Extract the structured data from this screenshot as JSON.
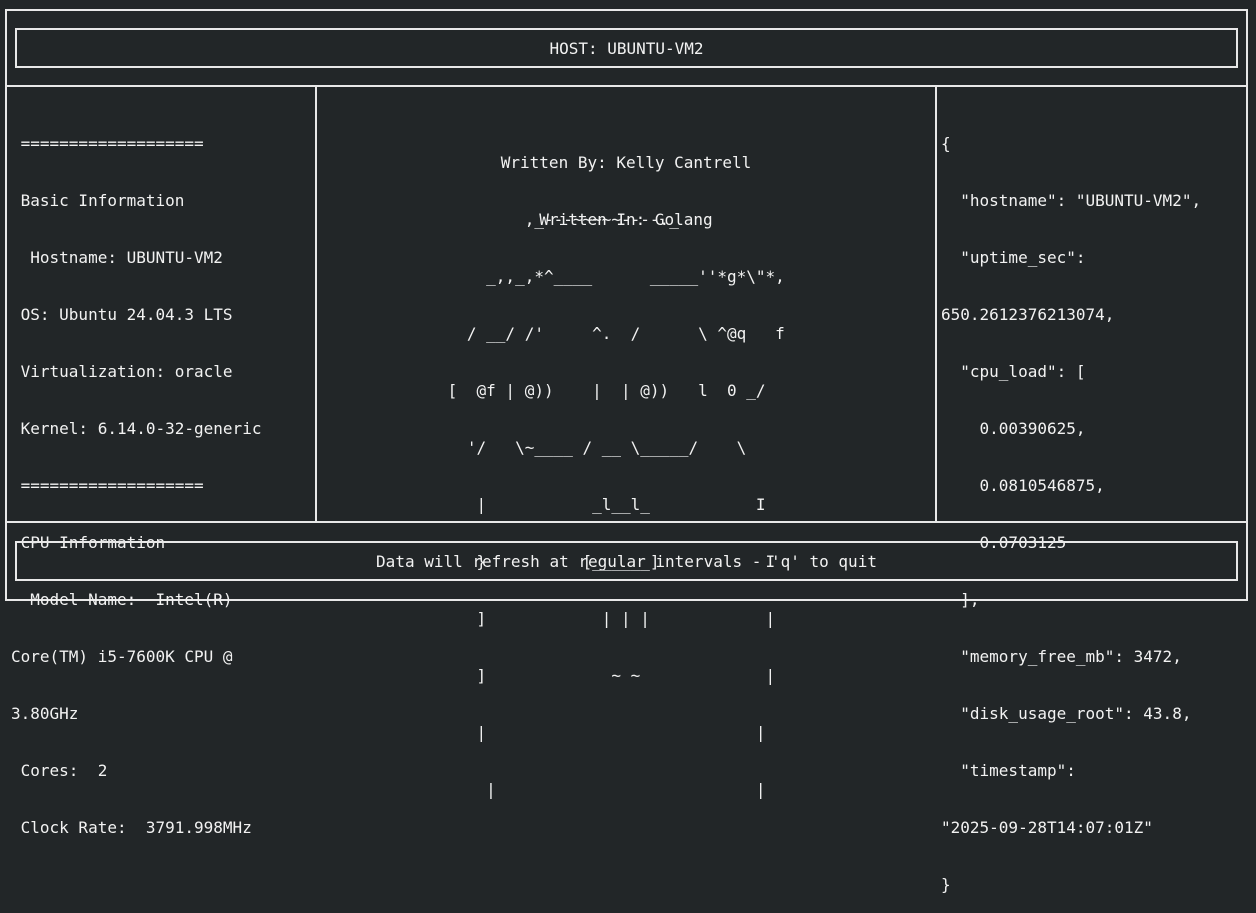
{
  "header": {
    "title": "HOST: UBUNTU-VM2"
  },
  "footer": {
    "message": "Data will refresh at regular intervals - 'q' to quit"
  },
  "left_panel": {
    "lines": [
      " ===================",
      " Basic Information",
      "  Hostname: UBUNTU-VM2",
      " OS: Ubuntu 24.04.3 LTS",
      " Virtualization: oracle",
      " Kernel: 6.14.0-32-generic",
      " ===================",
      " CPU Information",
      "  Model Name:  Intel(R)",
      "Core(TM) i5-7600K CPU @",
      "3.80GHz",
      " Cores:  2",
      " Clock Rate:  3791.998MHz"
    ]
  },
  "center_panel": {
    "author": "Written By: Kelly Cantrell",
    "language": "Written In: Golang",
    "ascii_art": [
      "         ,_---~~~~~----._",
      "     _,,_,*^____      _____''*g*\\\"*,",
      "   / __/ /'     ^.  /      \\ ^@q   f",
      " [  @f | @))    |  | @))   l  0 _/",
      "   '/   \\~____ / __ \\_____/    \\",
      "    |           _l__l_           I",
      "    }          [______]           I",
      "    ]            | | |            |",
      "    ]             ~ ~             |",
      "    |                            |",
      "     |                           |"
    ]
  },
  "right_panel": {
    "lines": [
      "{",
      "  \"hostname\": \"UBUNTU-VM2\",",
      "  \"uptime_sec\":",
      "650.2612376213074,",
      "  \"cpu_load\": [",
      "    0.00390625,",
      "    0.0810546875,",
      "    0.0703125",
      "  ],",
      "  \"memory_free_mb\": 3472,",
      "  \"disk_usage_root\": 43.8,",
      "  \"timestamp\":",
      "\"2025-09-28T14:07:01Z\"",
      "}"
    ]
  }
}
